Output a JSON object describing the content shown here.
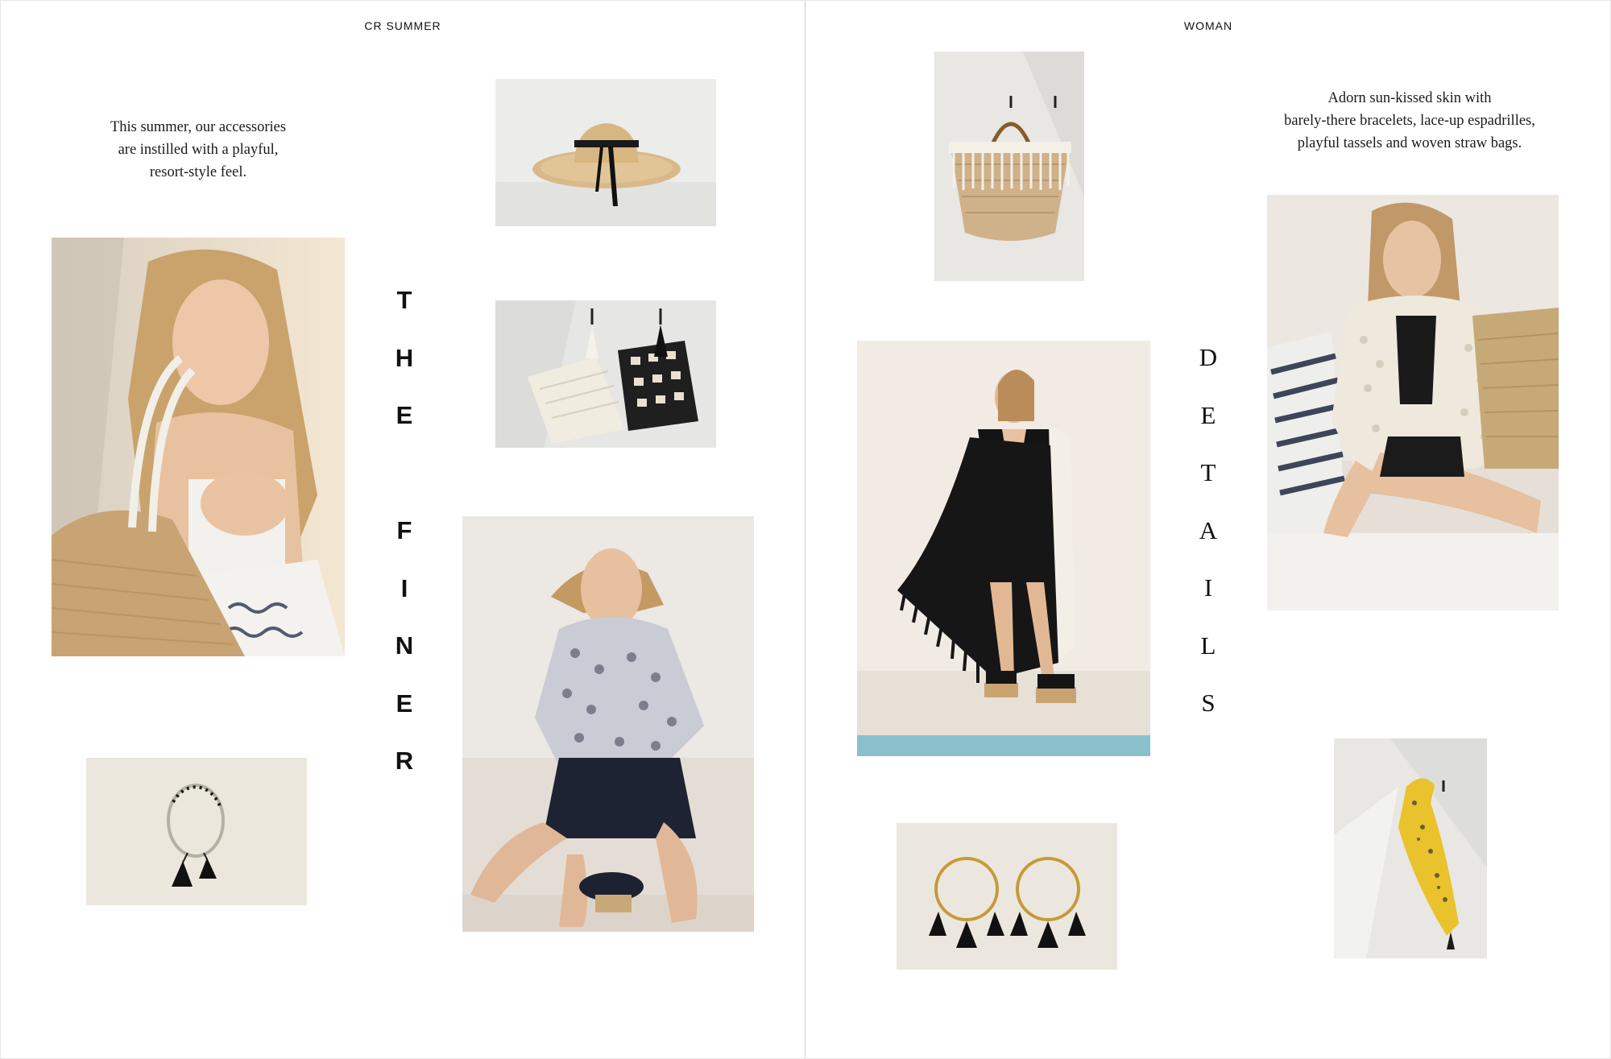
{
  "left_page": {
    "running_head": "CR SUMMER",
    "intro": [
      "This summer, our accessories",
      "are instilled with a playful,",
      "resort-style feel."
    ],
    "heading_letters": [
      "T",
      "H",
      "E",
      "",
      "F",
      "I",
      "N",
      "E",
      "R"
    ]
  },
  "right_page": {
    "running_head": "WOMAN",
    "intro": [
      "Adorn sun-kissed skin with",
      "barely-there bracelets, lace-up espadrilles,",
      "playful tassels and woven straw bags."
    ],
    "heading_letters": [
      "D",
      "E",
      "T",
      "A",
      "I",
      "L",
      "S"
    ]
  }
}
